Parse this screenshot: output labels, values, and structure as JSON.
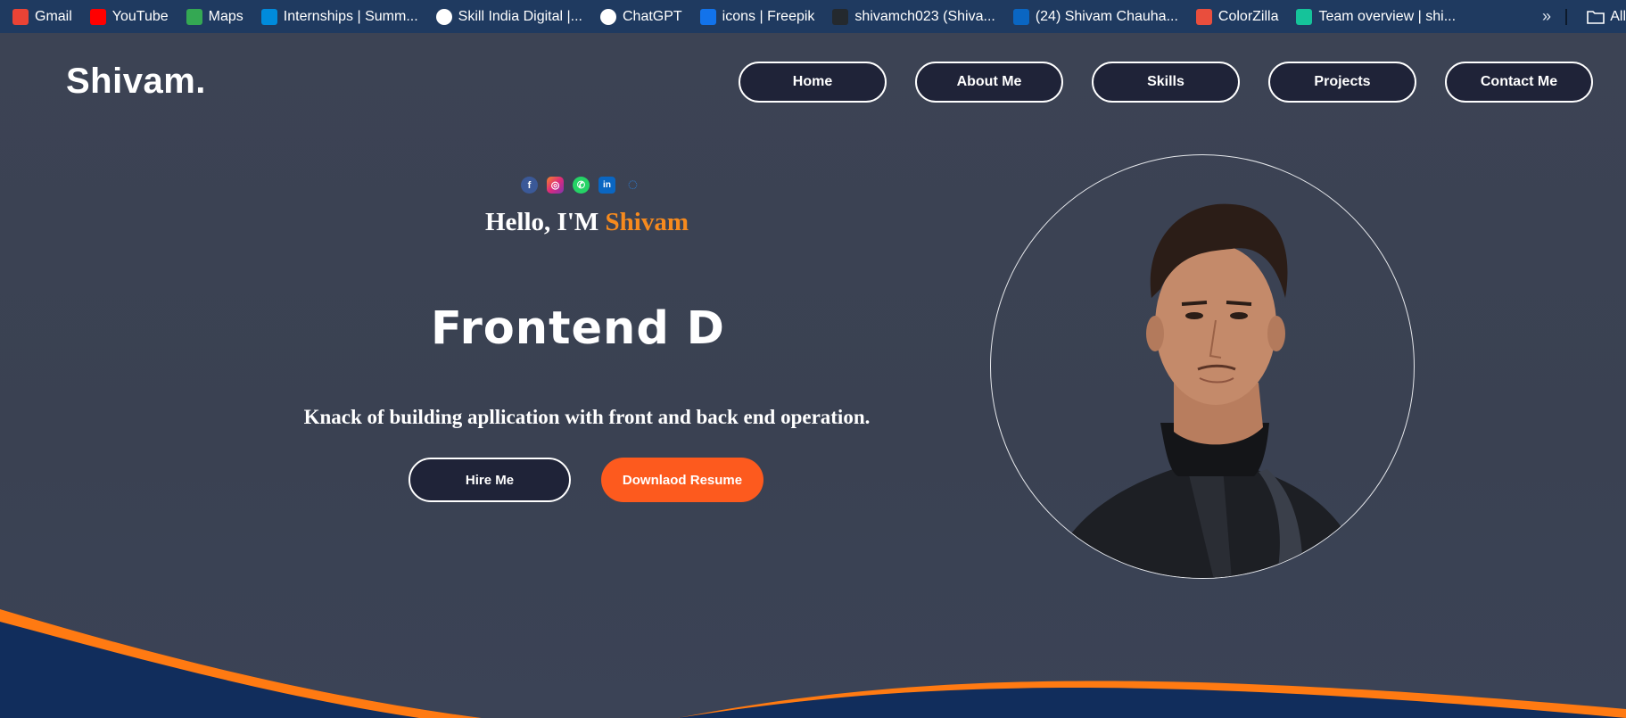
{
  "bookmarks": [
    {
      "label": "Gmail",
      "icon": "gmail-icon",
      "color": "#ea4335"
    },
    {
      "label": "YouTube",
      "icon": "youtube-icon",
      "color": "#ff0000"
    },
    {
      "label": "Maps",
      "icon": "maps-icon",
      "color": "#34a853"
    },
    {
      "label": "Internships | Summ...",
      "icon": "internshala-icon",
      "color": "#008bdc"
    },
    {
      "label": "Skill India Digital |...",
      "icon": "skill-india-icon",
      "color": "#ffffff"
    },
    {
      "label": "ChatGPT",
      "icon": "chatgpt-icon",
      "color": "#ffffff"
    },
    {
      "label": "icons | Freepik",
      "icon": "freepik-icon",
      "color": "#1273eb"
    },
    {
      "label": "shivamch023 (Shiva...",
      "icon": "github-icon",
      "color": "#24292e"
    },
    {
      "label": "(24) Shivam Chauha...",
      "icon": "linkedin-icon",
      "color": "#0a66c2"
    },
    {
      "label": "ColorZilla",
      "icon": "colorzilla-icon",
      "color": "#e94e3d"
    },
    {
      "label": "Team overview | shi...",
      "icon": "team-overview-icon",
      "color": "#15c39a"
    }
  ],
  "bookmarks_more": "»",
  "bookmarks_all": "All",
  "logo": "Shivam.",
  "nav": [
    {
      "label": "Home"
    },
    {
      "label": "About Me"
    },
    {
      "label": "Skills"
    },
    {
      "label": "Projects"
    },
    {
      "label": "Contact Me"
    }
  ],
  "socials": [
    {
      "icon": "facebook-icon",
      "glyph": "f",
      "color": "#3b5998"
    },
    {
      "icon": "instagram-icon",
      "glyph": "◎",
      "color": "#e1306c"
    },
    {
      "icon": "whatsapp-icon",
      "glyph": "✆",
      "color": "#25d366"
    },
    {
      "icon": "linkedin-icon",
      "glyph": "in",
      "color": "#0a66c2"
    },
    {
      "icon": "loading-icon",
      "glyph": "◌",
      "color": "#2d7dd2"
    }
  ],
  "hero": {
    "hello_prefix": "Hello, I'M ",
    "hello_name": "Shivam",
    "role": "Frontend D",
    "tagline": "Knack of building apllication with front and back end operation.",
    "hire_label": "Hire Me",
    "resume_label": "Downlaod Resume"
  },
  "colors": {
    "accent_orange": "#f68a1e",
    "resume_button": "#fd5a1e",
    "nav_button_bg": "#1f2338",
    "page_bg": "#3b4253",
    "wave_navy": "#112d5c",
    "wave_orange": "#ff7a12"
  }
}
